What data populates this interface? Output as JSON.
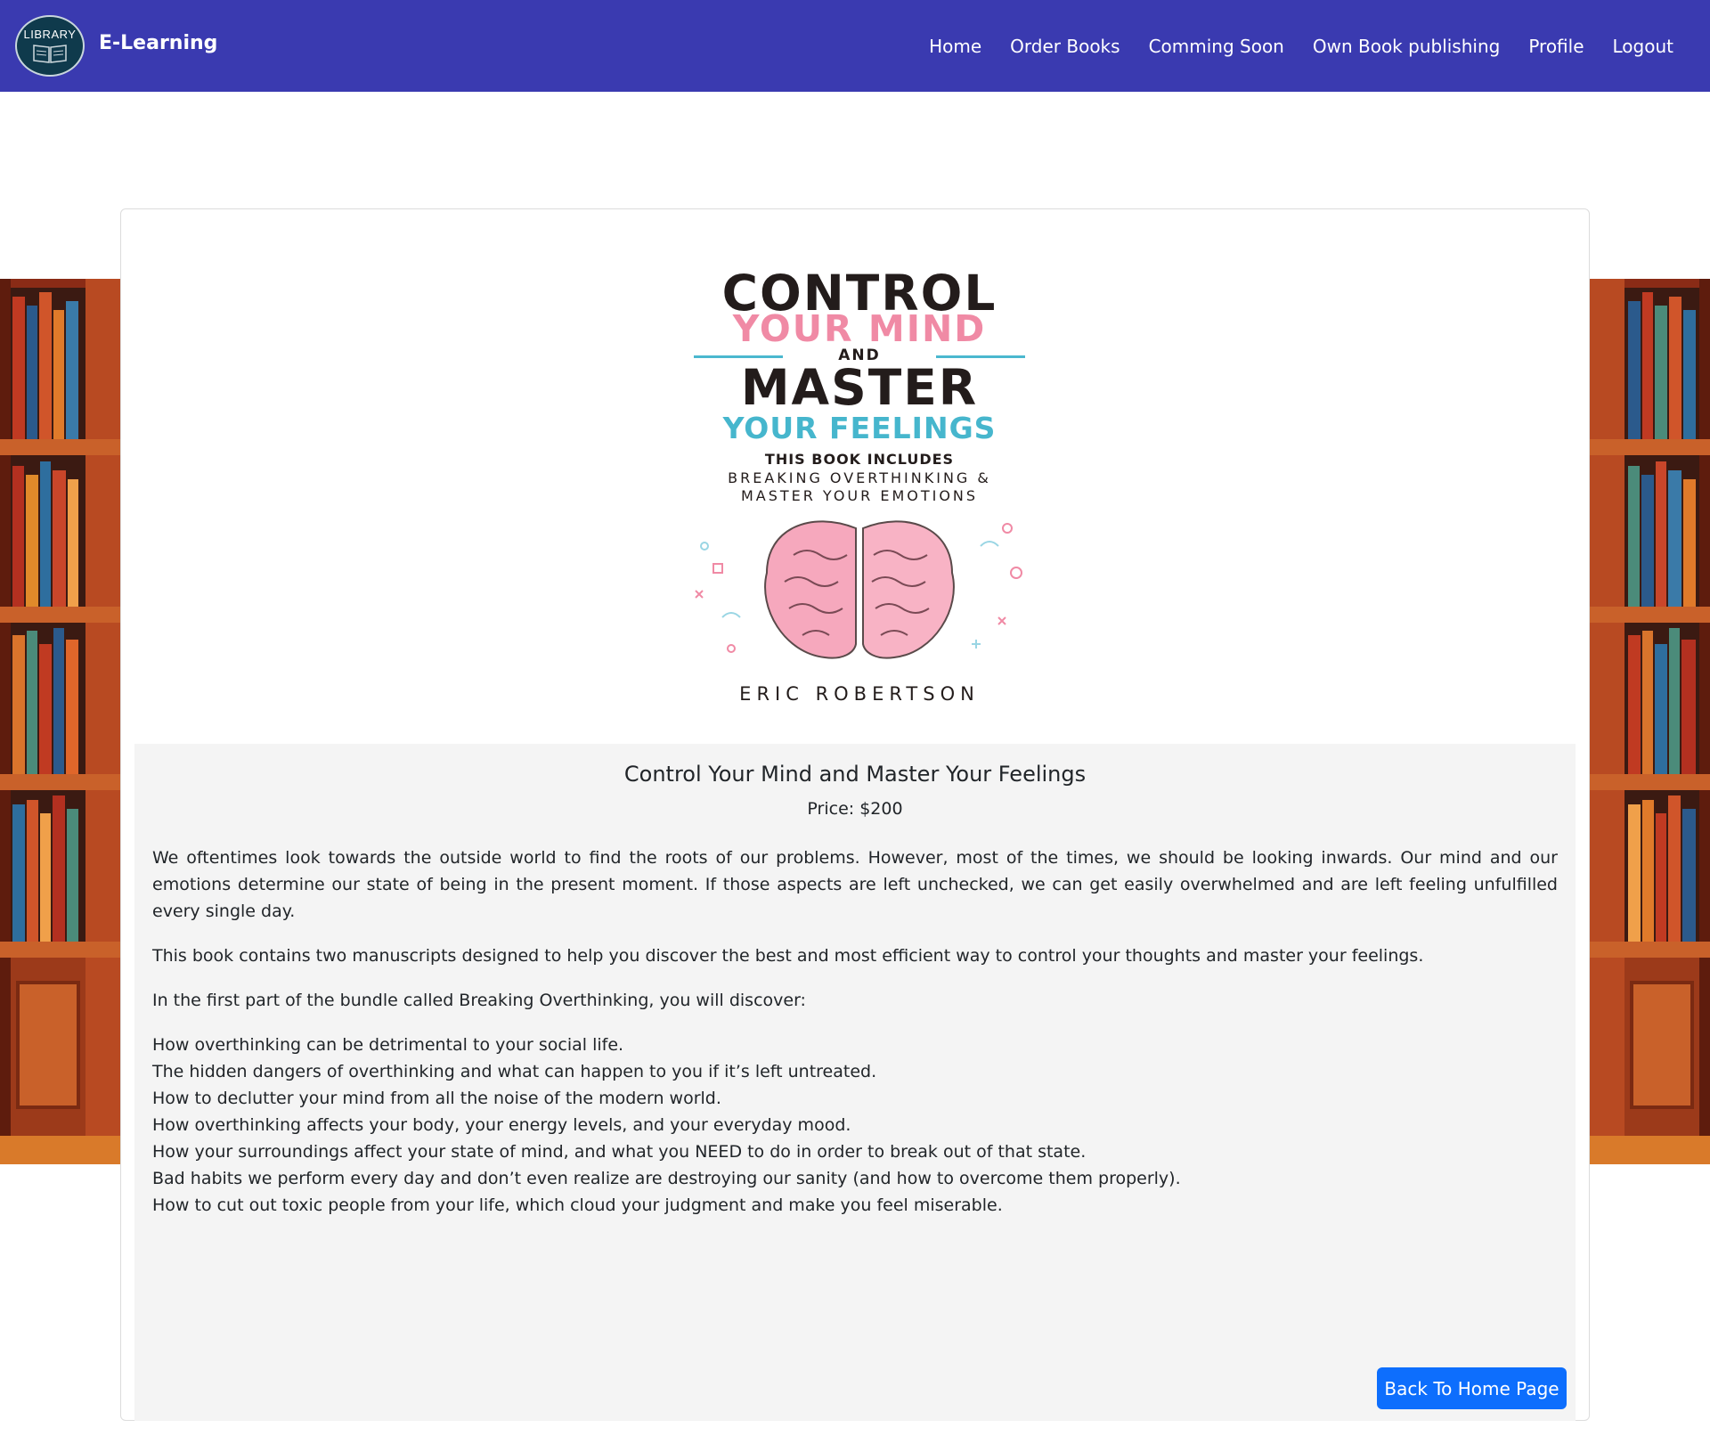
{
  "navbar": {
    "logo_text": "LIBRARY",
    "brand": "E-Learning",
    "links": [
      "Home",
      "Order Books",
      "Comming Soon",
      "Own Book publishing",
      "Profile",
      "Logout"
    ]
  },
  "cover": {
    "line1": "CONTROL",
    "line2": "YOUR MIND",
    "line3": "AND",
    "line4": "MASTER",
    "line5": "YOUR FEELINGS",
    "line6": "THIS BOOK INCLUDES",
    "line7a": "BREAKING OVERTHINKING &",
    "line7b": "MASTER YOUR EMOTIONS",
    "author": "ERIC ROBERTSON"
  },
  "book": {
    "title": "Control Your Mind and Master Your Feelings",
    "price": "Price: $200",
    "paragraphs": [
      "We oftentimes look towards the outside world to find the roots of our problems. However, most of the times, we should be looking inwards. Our mind and our emotions determine our state of being in the present moment. If those aspects are left unchecked, we can get easily overwhelmed and are left feeling unfulfilled every single day.",
      "This book contains two manuscripts designed to help you discover the best and most efficient way to control your thoughts and master your feelings.",
      "In the first part of the bundle called Breaking Overthinking, you will discover:"
    ],
    "bullets": [
      "How overthinking can be detrimental to your social life.",
      "The hidden dangers of overthinking and what can happen to you if it’s left untreated.",
      "How to declutter your mind from all the noise of the modern world.",
      "How overthinking affects your body, your energy levels, and your everyday mood.",
      "How your surroundings affect your state of mind, and what you NEED to do in order to break out of that state.",
      "Bad habits we perform every day and don’t even realize are destroying our sanity (and how to overcome them properly).",
      "How to cut out toxic people from your life, which cloud your judgment and make you feel miserable."
    ]
  },
  "actions": {
    "back_label": "Back To Home Page"
  },
  "colors": {
    "navbar": "#3a3ab0",
    "button": "#0d6efd",
    "panel": "#f4f4f4"
  }
}
